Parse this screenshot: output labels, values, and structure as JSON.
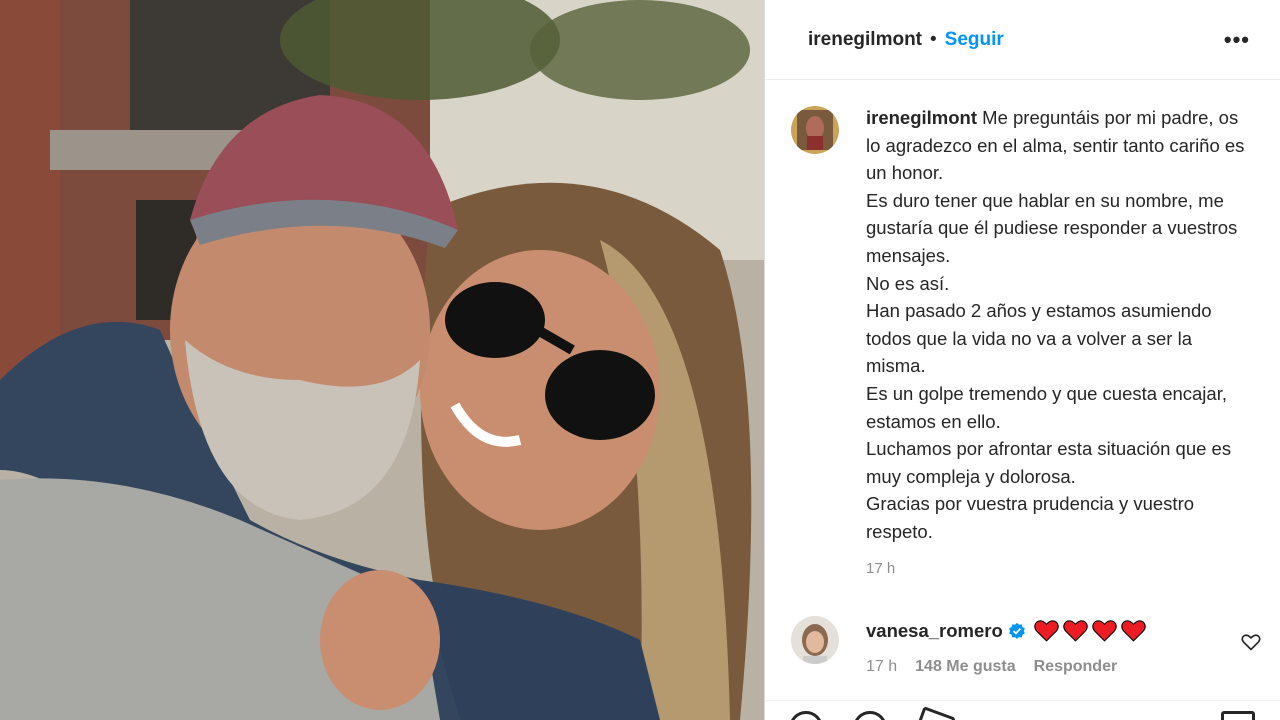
{
  "post": {
    "username": "irenegilmont",
    "separator": "•",
    "follow_label": "Seguir",
    "more_label": "•••"
  },
  "caption": {
    "username": "irenegilmont",
    "text": "Me preguntáis por mi padre, os lo agradezco en el alma, sentir tanto cariño es un honor.\nEs duro tener que hablar en su nombre, me gustaría que él pudiese responder a vuestros mensajes.\nNo es así.\nHan pasado 2 años y estamos asumiendo todos que la vida no va a volver a ser la misma.\nEs un golpe tremendo y que cuesta encajar, estamos en ello.\nLuchamos por afrontar esta situación que es muy compleja y dolorosa.\nGracias por vuestra prudencia y vuestro respeto.",
    "time": "17 h"
  },
  "comment": {
    "username": "vanesa_romero",
    "verified_icon": "verified-badge-icon",
    "hearts_count": 4,
    "heart_color": "#ed1c24",
    "time": "17 h",
    "likes": "148 Me gusta",
    "reply_label": "Responder"
  },
  "colors": {
    "accent": "#0095f6",
    "text": "#262626",
    "muted": "#8e8e8e"
  }
}
